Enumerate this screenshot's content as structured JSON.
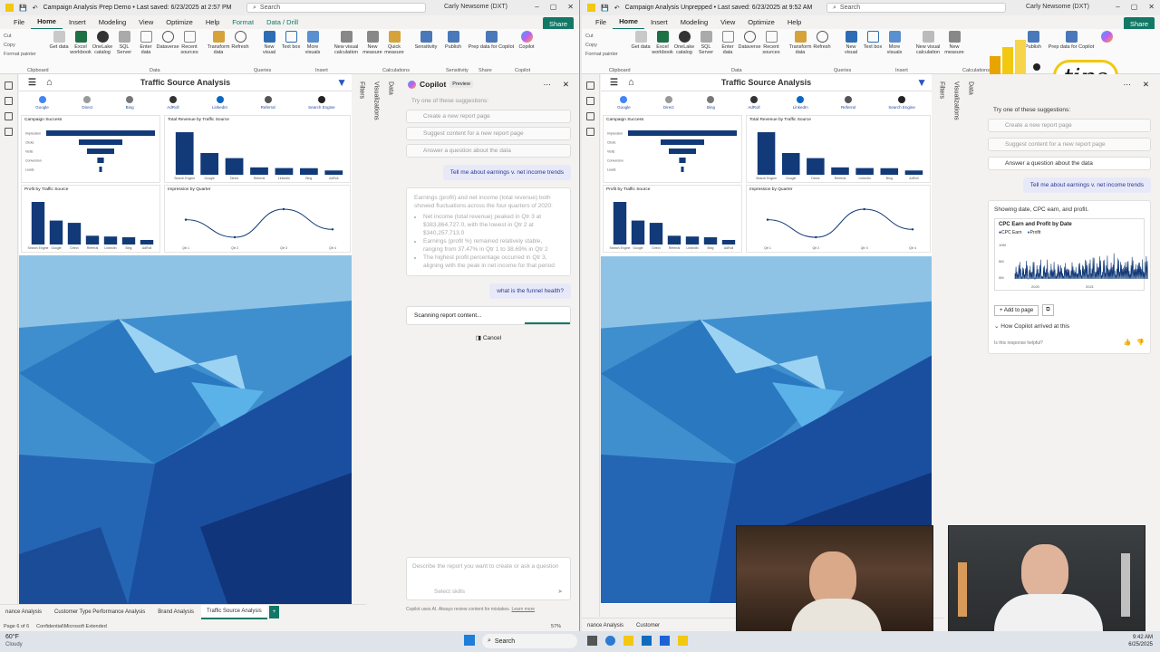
{
  "left": {
    "title": "Campaign Analysis Prep Demo • Last saved: 6/23/2025 at 2:57 PM",
    "search": "Search",
    "user": "Carly Newsome (DXT)",
    "menu": [
      "File",
      "Home",
      "Insert",
      "Modeling",
      "View",
      "Optimize",
      "Help",
      "Format",
      "Data / Drill"
    ],
    "report_title": "Traffic Source Analysis",
    "copilot_title": "Copilot",
    "copilot_badge": "Preview",
    "suggest_heading": "Try one of these suggestions:",
    "suggestions": [
      "Create a new report page",
      "Suggest content for a new report page",
      "Answer a question about the data"
    ],
    "user_msg_1": "Tell me about earnings v. net income trends",
    "answer_intro": "Earnings (profit) and net income (total revenue) both showed fluctuations across the four quarters of 2020:",
    "answer_bullets": [
      "Net income (total revenue) peaked in Qtr 3 at $383,864,727.0, with the lowest in Qtr 2 at $340,257,713.0",
      "Earnings (profit %) remained relatively stable, ranging from 37.47% in Qtr 1 to 38.69% in Qtr 2",
      "The highest profit percentage occurred in Qtr 3, aligning with the peak in net income for that period"
    ],
    "user_msg_2": "what is the funnel health?",
    "scanning": "Scanning report content...",
    "cancel": "Cancel",
    "input_placeholder": "Describe the report you want to create or ask a question",
    "select_skills": "Select skills",
    "disclaimer": "Copilot uses AI. Always review content for mistakes.",
    "learn_more": "Learn more",
    "tabs": [
      "nance Analysis",
      "Customer Type Performance Analysis",
      "Brand Analysis",
      "Traffic Source Analysis"
    ],
    "page_status": "Page 6 of 6",
    "sensitivity": "Confidential\\Microsoft Extended",
    "zoom": "57%",
    "weather_temp": "60°F",
    "weather_desc": "Cloudy"
  },
  "right": {
    "title": "Campaign Analysis Unprepped • Last saved: 6/23/2025 at 9:52 AM",
    "search": "Search",
    "user": "Carly Newsome (DXT)",
    "menu": [
      "File",
      "Home",
      "Insert",
      "Modeling",
      "View",
      "Optimize",
      "Help"
    ],
    "report_title": "Traffic Source Analysis",
    "suggest_heading": "Try one of these suggestions:",
    "suggestions": [
      "Create a new report page",
      "Suggest content for a new report page",
      "Answer a question about the data"
    ],
    "user_msg_1": "Tell me about earnings v. net income trends",
    "answer": "Showing date, CPC earn, and profit.",
    "chart_title": "CPC Earn and Profit by Date",
    "legend": [
      "CPC Earn",
      "Profit"
    ],
    "add_to_page": "Add to page",
    "how_arrived": "How Copilot arrived at this",
    "helpful": "Is this response helpful?",
    "tabs": [
      "nance Analysis",
      "Customer"
    ],
    "tips": "tips",
    "date": "6/25/2025",
    "time": "9:42 AM"
  },
  "ribbon": {
    "left_buttons": [
      "Get data",
      "Excel workbook",
      "OneLake catalog",
      "SQL Server",
      "Enter data",
      "Dataverse",
      "Recent sources",
      "Transform data",
      "Refresh",
      "New visual",
      "Text box",
      "More visuals",
      "New visual calculation",
      "New measure",
      "Quick measure",
      "Sensitivity",
      "Publish",
      "Prep data for Copilot",
      "Copilot"
    ],
    "groups": [
      "Clipboard",
      "Data",
      "Queries",
      "Insert",
      "Calculations",
      "Sensitivity",
      "Share",
      "Copilot"
    ],
    "clipboard": [
      "Cut",
      "Copy",
      "Format painter"
    ]
  },
  "sources": [
    "Google",
    "Direct",
    "Bing",
    "AdRoll",
    "LinkedIn",
    "Referral",
    "Search Engine"
  ],
  "tiles": {
    "campaign_success": "Campaign Success",
    "revenue": "Total Revenue by Traffic Source",
    "profit": "Profit by Traffic Source",
    "impression": "Impression by Quarter"
  },
  "taskbar_search": "Search",
  "colors": {
    "accent": "#117865",
    "bar": "#123a78",
    "sky": "#86bde3"
  },
  "chart_data": [
    {
      "type": "bar",
      "title": "Total Revenue by Traffic Source",
      "categories": [
        "Search Engine",
        "Google",
        "Direct",
        "Referral",
        "LinkedIn",
        "Bing",
        "AdRoll"
      ],
      "values": [
        3.17,
        1.62,
        1.24,
        0.55,
        0.5,
        0.49,
        0.32
      ]
    },
    {
      "type": "bar",
      "title": "Profit by Traffic Source",
      "categories": [
        "Search Engine",
        "Google",
        "Direct",
        "Referral",
        "LinkedIn",
        "Bing",
        "AdRoll"
      ],
      "values": [
        1.12,
        0.63,
        0.57,
        0.23,
        0.21,
        0.19,
        0.12
      ]
    },
    {
      "type": "line",
      "title": "Impression by Quarter",
      "categories": [
        "Qtr 1",
        "Qtr 2",
        "Qtr 3",
        "Qtr 4"
      ],
      "values": [
        8.1,
        6.1,
        9.3,
        7.0
      ]
    },
    {
      "type": "bar",
      "title": "Campaign Success",
      "categories": [
        "Impression",
        "Clicks",
        "Visits",
        "Conversion",
        "Leads"
      ],
      "values": [
        100,
        40,
        25,
        6,
        2
      ]
    }
  ]
}
